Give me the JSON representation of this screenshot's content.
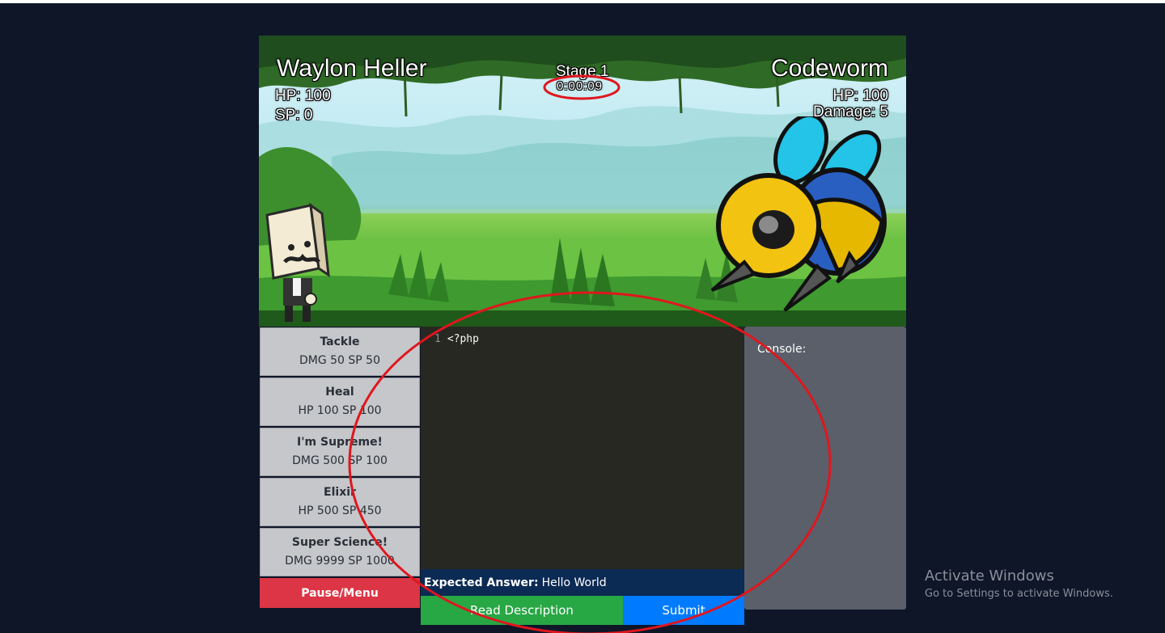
{
  "battle": {
    "player": {
      "name": "Waylon Heller",
      "hp": "HP: 100",
      "sp": "SP: 0"
    },
    "stage": {
      "label": "Stage 1",
      "timer": "0:00:09"
    },
    "enemy": {
      "name": "Codeworm",
      "hp": "HP: 100",
      "damage": "Damage: 5"
    }
  },
  "skills": [
    {
      "name": "Tackle",
      "stats": "DMG 50 SP 50"
    },
    {
      "name": "Heal",
      "stats": "HP 100 SP 100"
    },
    {
      "name": "I'm Supreme!",
      "stats": "DMG 500 SP 100"
    },
    {
      "name": "Elixir",
      "stats": "HP 500 SP 450"
    },
    {
      "name": "Super Science!",
      "stats": "DMG 9999 SP 1000"
    }
  ],
  "pause_label": "Pause/Menu",
  "editor": {
    "line_number": "1",
    "code": "<?php"
  },
  "expected": {
    "label": "Expected Answer:",
    "value": "Hello World"
  },
  "actions": {
    "read_description": "Read Description",
    "submit": "Submit"
  },
  "console": {
    "label": "Console:"
  },
  "watermark": {
    "title": "Activate Windows",
    "subtitle": "Go to Settings to activate Windows."
  },
  "colors": {
    "page_bg": "#0e1628",
    "pause": "#dc3545",
    "read_description": "#28a745",
    "submit": "#007bff",
    "editor_bg": "#272822",
    "console_bg": "#5a5f6a",
    "annotation": "#e0161e"
  },
  "icons": [
    "player-character-icon",
    "codeworm-bee-icon"
  ]
}
